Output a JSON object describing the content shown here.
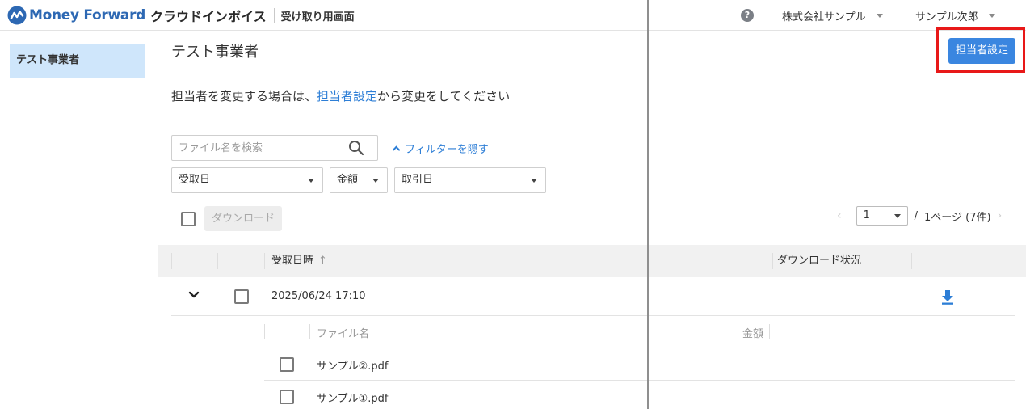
{
  "header": {
    "brand": "Money Forward",
    "product": "クラウドインボイス",
    "subtitle": "受け取り用画面",
    "company": "株式会社サンプル",
    "user": "サンプル次郎"
  },
  "sidebar": {
    "items": [
      {
        "label": "テスト事業者"
      }
    ]
  },
  "main": {
    "title": "テスト事業者",
    "settings_button": "担当者設定",
    "notice": {
      "before": "担当者を変更する場合は、",
      "link": "担当者設定",
      "after": "から変更をしてください"
    },
    "search_placeholder": "ファイル名を検索",
    "filter_toggle": "フィルターを隠す",
    "filters": {
      "received_date": "受取日",
      "amount": "金額",
      "transaction_date": "取引日"
    },
    "download_button": "ダウンロード",
    "pagination": {
      "page": "1",
      "slash": "/",
      "summary": "1ページ (7件)"
    }
  },
  "table": {
    "columns": {
      "received_at": "受取日時",
      "download_status": "ダウンロード状況"
    },
    "rows": [
      {
        "received_at": "2025/06/24 17:10",
        "sub_columns": {
          "file_name": "ファイル名",
          "amount": "金額"
        },
        "files": [
          {
            "name": "サンプル②.pdf"
          },
          {
            "name": "サンプル①.pdf"
          }
        ]
      }
    ]
  },
  "colors": {
    "brand": "#2d68b3",
    "primary": "#3a86e0",
    "link": "#2d7ed6",
    "highlight_frame": "#e81818",
    "sidebar_active": "#cfe6fb"
  }
}
